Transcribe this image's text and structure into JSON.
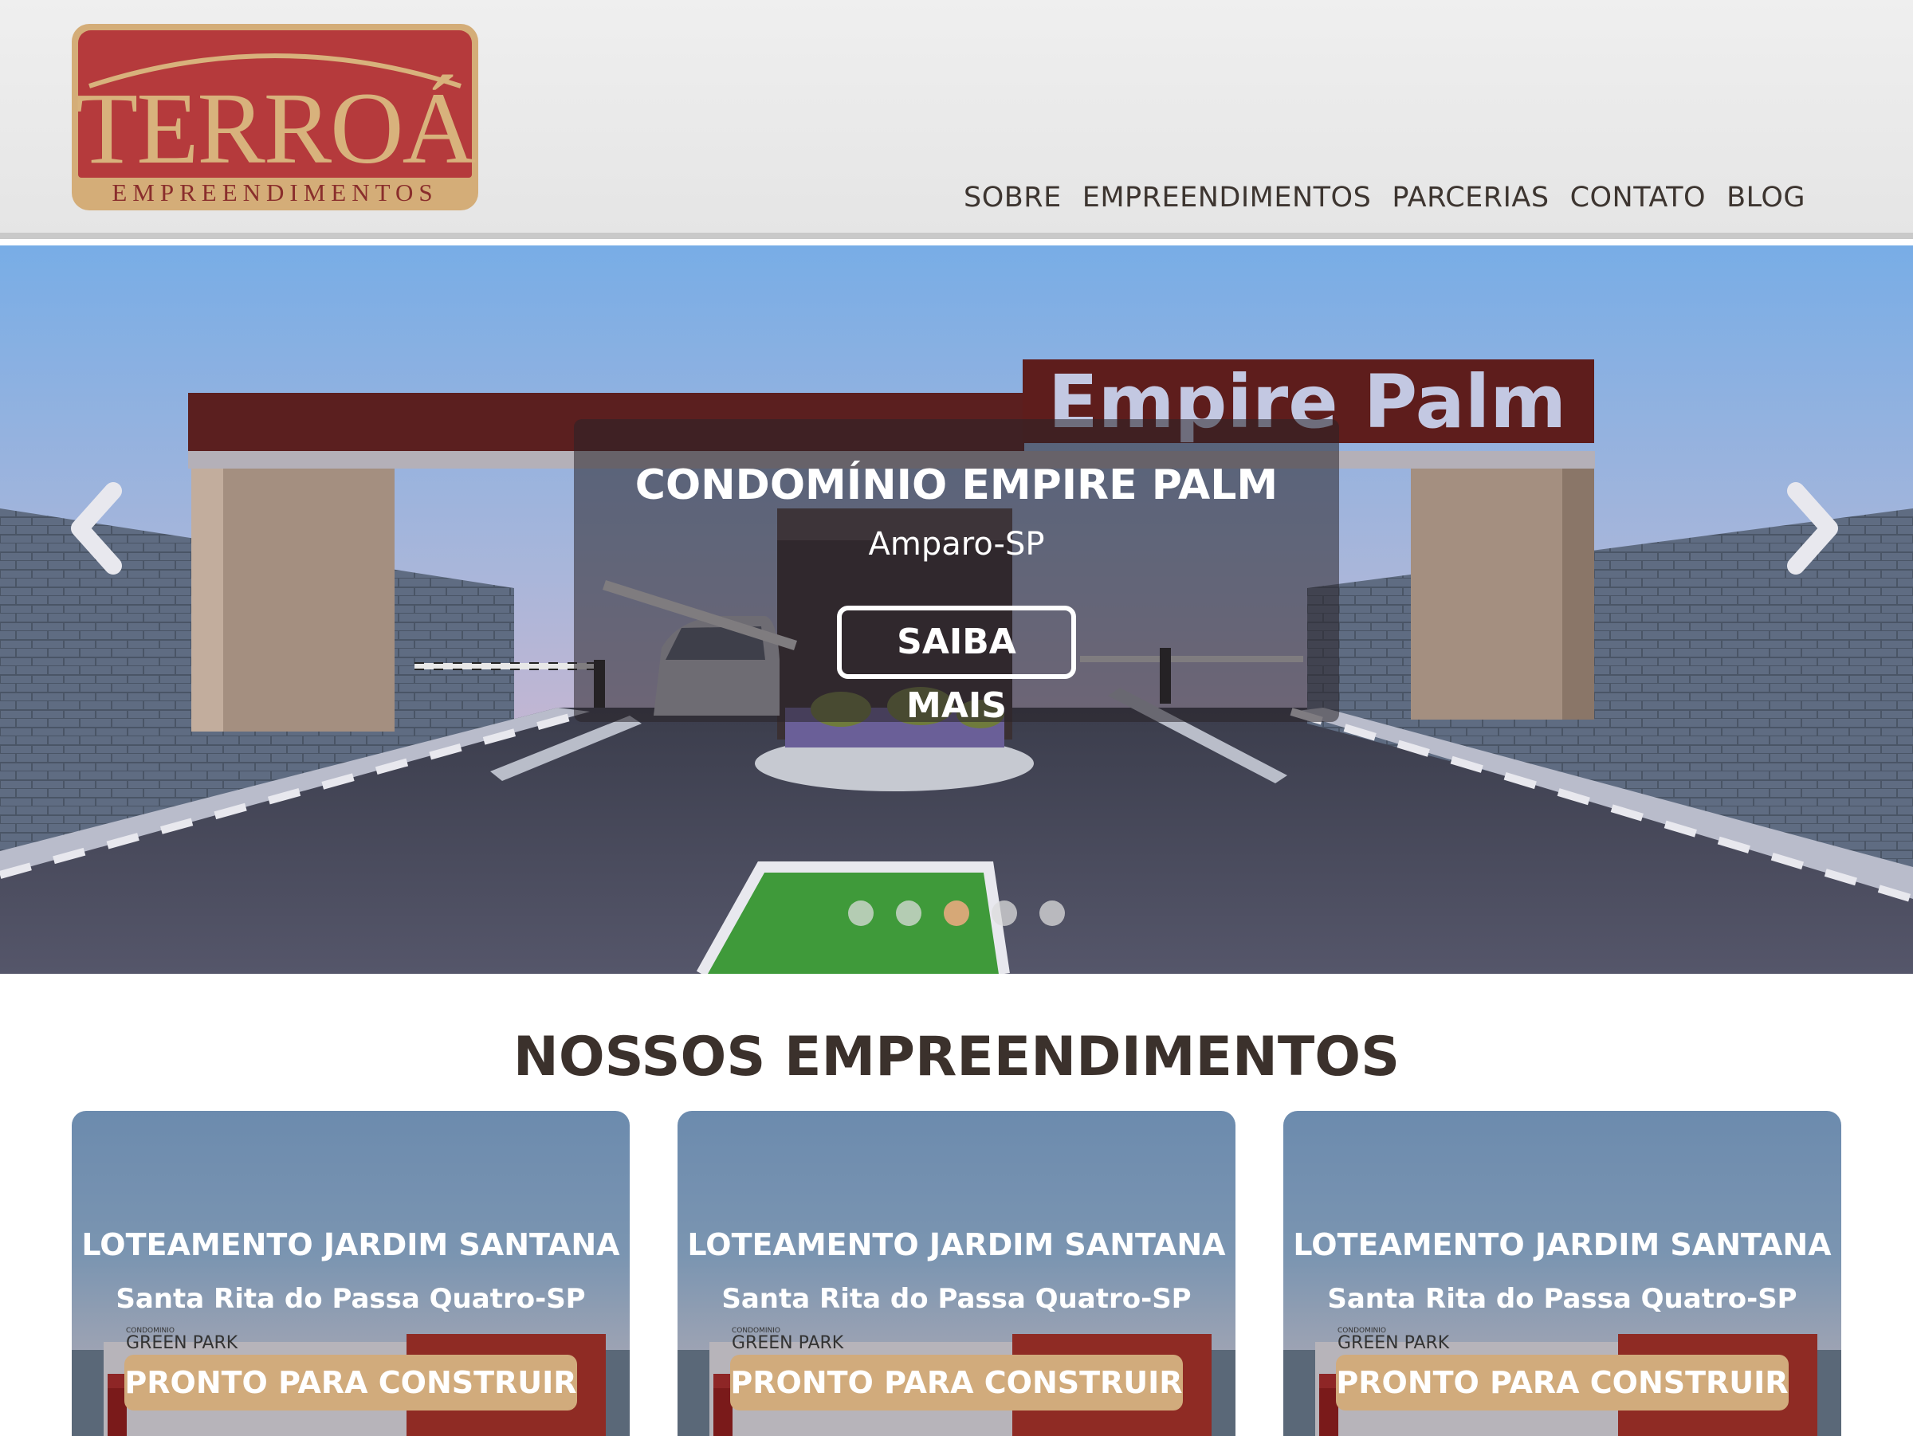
{
  "brand": {
    "name": "TERROÁ",
    "tagline": "EMPREENDIMENTOS"
  },
  "nav": {
    "items": [
      {
        "label": "SOBRE"
      },
      {
        "label": "EMPREENDIMENTOS"
      },
      {
        "label": "PARCERIAS"
      },
      {
        "label": "CONTATO"
      },
      {
        "label": "BLOG"
      }
    ]
  },
  "hero": {
    "sign_text": "Empire Palm",
    "title": "CONDOMÍNIO EMPIRE PALM",
    "subtitle": "Amparo-SP",
    "button_label": "SAIBA MAIS",
    "slide_count": 5,
    "active_slide": 3
  },
  "section": {
    "title": "NOSSOS EMPREENDIMENTOS"
  },
  "cards": [
    {
      "title": "LOTEAMENTO JARDIM SANTANA",
      "location": "Santa Rita do Passa Quatro-SP",
      "badge": "PRONTO PARA CONSTRUIR",
      "sign_small": "CONDOMINIO",
      "sign_big": "GREEN PARK"
    },
    {
      "title": "LOTEAMENTO JARDIM SANTANA",
      "location": "Santa Rita do Passa Quatro-SP",
      "badge": "PRONTO PARA CONSTRUIR",
      "sign_small": "CONDOMINIO",
      "sign_big": "GREEN PARK"
    },
    {
      "title": "LOTEAMENTO JARDIM SANTANA",
      "location": "Santa Rita do Passa Quatro-SP",
      "badge": "PRONTO PARA CONSTRUIR",
      "sign_small": "CONDOMINIO",
      "sign_big": "GREEN PARK"
    }
  ],
  "colors": {
    "brand_red": "#b53a3c",
    "brand_gold": "#d4ad78",
    "text_dark": "#3b312c",
    "dot_active": "#d6a877"
  }
}
